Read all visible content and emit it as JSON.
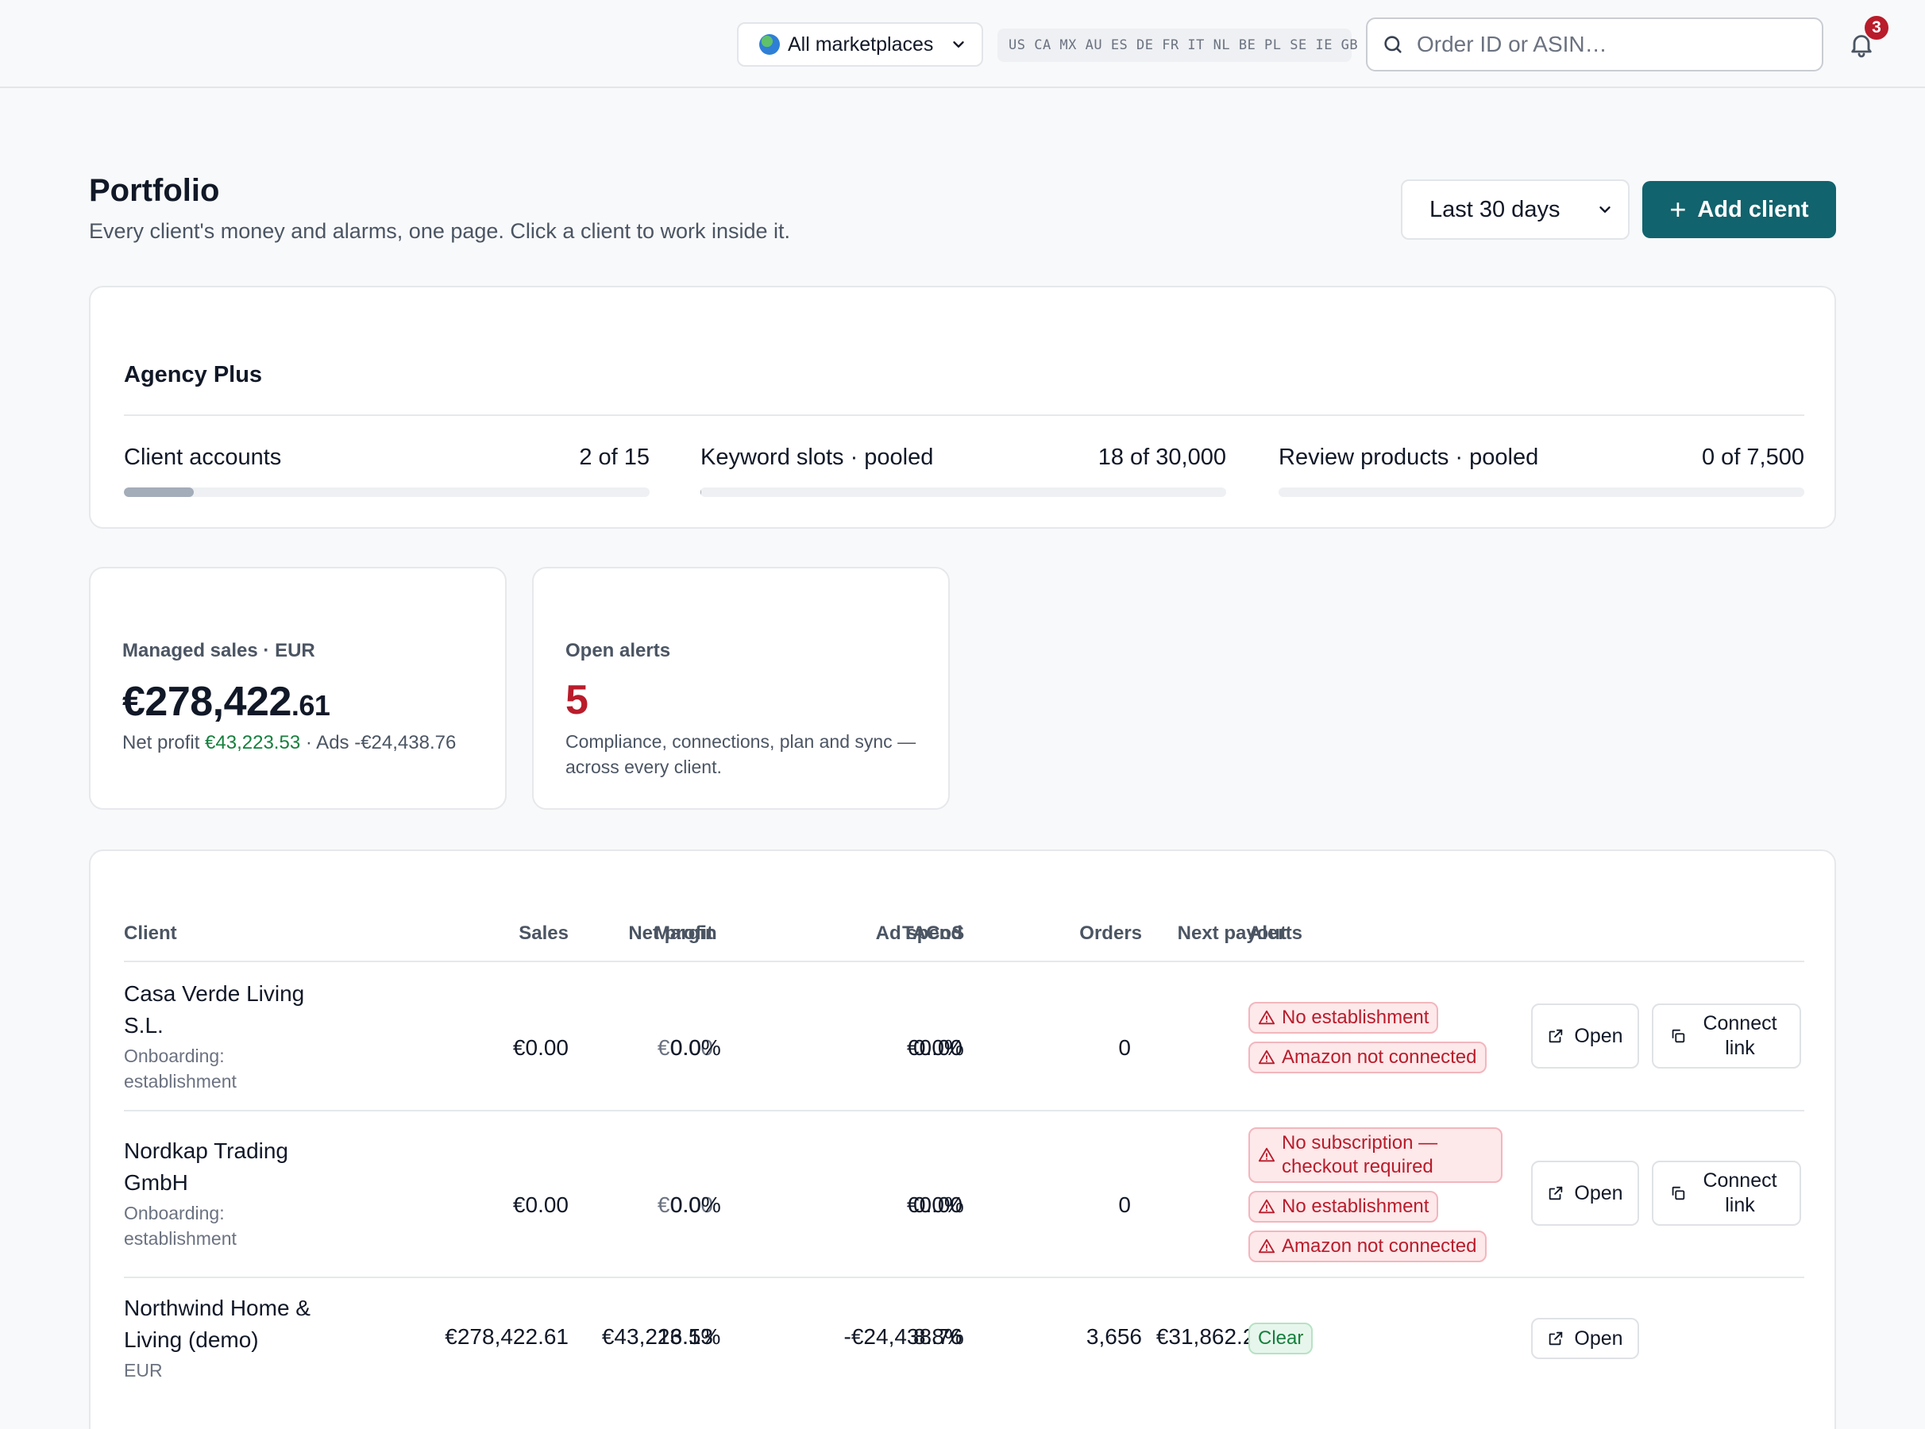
{
  "topbar": {
    "marketplace_select": "All marketplaces",
    "marketplace_codes": "US CA MX AU ES DE FR IT NL BE PL SE IE GB",
    "search_placeholder": "Order ID or ASIN…",
    "notification_count": "3",
    "icons": [
      "globe-icon",
      "chevron-down-icon",
      "info-icon",
      "search-icon",
      "bell-icon"
    ]
  },
  "header": {
    "title": "Portfolio",
    "subtitle": "Every client's money and alarms, one page. Click a client to work inside it.",
    "date_range": "Last 30 days",
    "add_client_label": "Add client"
  },
  "plan": {
    "name": "Agency Plus",
    "usage": [
      {
        "label": "Client accounts",
        "value": "2 of 15",
        "fraction": 0.133
      },
      {
        "label": "Keyword slots · pooled",
        "value": "18 of 30,000",
        "fraction": 0.0006
      },
      {
        "label": "Review products · pooled",
        "value": "0 of 7,500",
        "fraction": 0
      }
    ]
  },
  "stats": {
    "managed_sales": {
      "label": "Managed sales · EUR",
      "amount_main": "€278,422",
      "amount_cents": ".61",
      "net_profit_prefix": "Net profit",
      "net_profit_value": "€43,223.53",
      "ads_text": "· Ads -€24,438.76"
    },
    "open_alerts": {
      "label": "Open alerts",
      "count": "5",
      "description": "Compliance, connections, plan and sync — across every client."
    }
  },
  "table": {
    "headers": {
      "client": "Client",
      "sales": "Sales",
      "net_profit": "Net profit",
      "margin": "Margin",
      "ad_spend": "Ad spend",
      "tacos": "TACoS",
      "orders": "Orders",
      "next_payout": "Next payout",
      "alerts": "Alerts"
    },
    "rows": [
      {
        "name": "Casa Verde Living S.L.",
        "meta": "Onboarding: establishment",
        "sales": "€0.00",
        "net_profit": "€0.00",
        "margin": "0.0%",
        "ad_spend": "€0.00",
        "tacos": "0.0%",
        "orders": "0",
        "next_payout": "—",
        "alerts": [
          "No establishment",
          "Amazon not connected"
        ],
        "open_label": "Open",
        "connect_label": "Connect link"
      },
      {
        "name": "Nordkap Trading GmbH",
        "meta": "Onboarding: establishment",
        "sales": "€0.00",
        "net_profit": "€0.00",
        "margin": "0.0%",
        "ad_spend": "€0.00",
        "tacos": "0.0%",
        "orders": "0",
        "next_payout": "—",
        "alerts": [
          "No subscription — checkout required",
          "No establishment",
          "Amazon not connected"
        ],
        "open_label": "Open",
        "connect_label": "Connect link"
      },
      {
        "name": "Northwind Home & Living (demo)",
        "meta": "EUR",
        "sales": "€278,422.61",
        "net_profit": "€43,223.53",
        "margin": "16.1%",
        "ad_spend": "-€24,438.76",
        "tacos": "8.8%",
        "orders": "3,656",
        "next_payout": "€31,862.21",
        "next_payout_suffix": "est",
        "status": "Clear",
        "open_label": "Open"
      }
    ]
  },
  "colors": {
    "accent": "#11636d",
    "danger": "#b91c2b",
    "success": "#15803d",
    "page_bg": "#f8f9fa"
  }
}
